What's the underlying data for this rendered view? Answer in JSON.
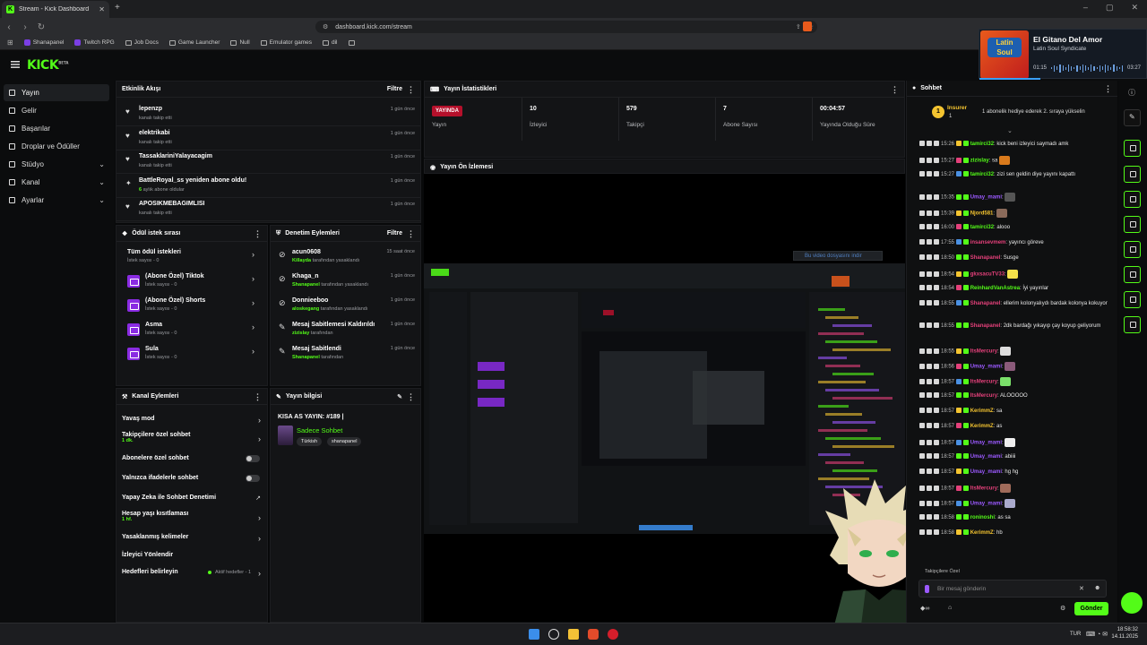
{
  "browser": {
    "tab_title": "Stream - Kick Dashboard",
    "url": "dashboard.kick.com/stream",
    "bookmarks": [
      "Shanapanel",
      "Twitch RPG",
      "Job Docs",
      "Game Launcher",
      "Null",
      "Emulator games",
      "dil",
      ""
    ]
  },
  "music": {
    "title": "El Gitano Del Amor",
    "artist": "Latin Soul Syndicate",
    "album_text": "Latin Soul",
    "elapsed": "01:15",
    "duration": "03:27",
    "progress": 0.36
  },
  "logo": "KICK",
  "logo_sup": "BETA",
  "sidebar": [
    {
      "label": "Yayın",
      "active": true,
      "icon": "broadcast-icon"
    },
    {
      "label": "Gelir",
      "icon": "wallet-icon"
    },
    {
      "label": "Başarılar",
      "icon": "trophy-icon"
    },
    {
      "label": "Droplar ve Ödüller",
      "icon": "gift-icon"
    },
    {
      "label": "Stüdyo",
      "icon": "studio-icon",
      "chevron": true
    },
    {
      "label": "Kanal",
      "icon": "channel-icon",
      "chevron": true
    },
    {
      "label": "Ayarlar",
      "icon": "gear-icon",
      "chevron": true
    }
  ],
  "activity": {
    "title": "Etkinlik Akışı",
    "filter": "Filtre",
    "items": [
      {
        "name": "lepenzp",
        "sub": "kanalı takip etti",
        "time": "1 gün önce"
      },
      {
        "name": "elektrikabi",
        "sub": "kanalı takip etti",
        "time": "1 gün önce"
      },
      {
        "name": "TassaklariniYalayacagim",
        "sub": "kanalı takip etti",
        "time": "1 gün önce"
      },
      {
        "name": "BattleRoyal_ss yeniden abone oldu!",
        "sub_green": "6",
        "sub": " aylık abone oldular",
        "time": "1 gün önce"
      },
      {
        "name": "APOSIKMEBAGIMLISI",
        "sub": "kanalı takip etti",
        "time": "1 gün önce"
      }
    ]
  },
  "rewards": {
    "title": "Ödül istek sırası",
    "items": [
      {
        "title": "Tüm ödül istekleri",
        "sub": "İstek sayısı - 0"
      },
      {
        "title": "(Abone Özel) Tiktok",
        "sub": "İstek sayısı - 0"
      },
      {
        "title": "(Abone Özel) Shorts",
        "sub": "İstek sayısı - 0"
      },
      {
        "title": "Asma",
        "sub": "İstek sayısı - 0"
      },
      {
        "title": "Sula",
        "sub": "İstek sayısı - 0"
      }
    ]
  },
  "moderation": {
    "title": "Denetim Eylemleri",
    "filter": "Filtre",
    "items": [
      {
        "title": "acun0608",
        "by": "Killayda",
        "sub": " tarafından yasaklandı",
        "time": "15 saat önce"
      },
      {
        "title": "Khaga_n",
        "by": "Shanapanel",
        "sub": " tarafından yasaklandı",
        "time": "1 gün önce"
      },
      {
        "title": "Donnieeboo",
        "by": "aloskegang",
        "sub": " tarafından yasaklandı",
        "time": "1 gün önce"
      },
      {
        "title": "Mesaj Sabitlemesi Kaldırıldı",
        "by": "zizislay",
        "sub": " tarafından",
        "time": "1 gün önce"
      },
      {
        "title": "Mesaj Sabitlendi",
        "by": "Shanapanel",
        "sub": " tarafından",
        "time": "1 gün önce"
      }
    ]
  },
  "channel_actions": {
    "title": "Kanal Eylemleri",
    "items": [
      {
        "label": "Yavaş mod",
        "control": "arrow"
      },
      {
        "label": "Takipçilere özel sohbet",
        "sub": "1 dk.",
        "control": "arrow"
      },
      {
        "label": "Abonelere özel sohbet",
        "control": "toggle"
      },
      {
        "label": "Yalnızca ifadelerle sohbet",
        "control": "toggle"
      },
      {
        "label": "Yapay Zeka ile Sohbet Denetimi",
        "control": "external"
      },
      {
        "label": "Hesap yaşı kısıtlaması",
        "sub": "1 hf.",
        "control": "arrow"
      },
      {
        "label": "Yasaklanmış kelimeler",
        "control": "arrow"
      },
      {
        "label": "İzleyici Yönlendir",
        "control": "none"
      },
      {
        "label": "Hedefleri belirleyin",
        "extra": "Aktif hedefler - 1",
        "control": "arrow"
      }
    ]
  },
  "stream_info": {
    "title": "Yayın bilgisi",
    "stream_title": "KISA AS YAYIN: #189 |",
    "category": "Sadece Sohbet",
    "tags": [
      "Türkish",
      "shanapanel"
    ]
  },
  "stats": {
    "title": "Yayın İstatistikleri",
    "live_badge": "YAYINDA",
    "live_label": "Yayın",
    "items": [
      {
        "value": "10",
        "label": "İzleyici"
      },
      {
        "value": "579",
        "label": "Takipçi"
      },
      {
        "value": "7",
        "label": "Abone Sayısı"
      },
      {
        "value": "00:04:57",
        "label": "Yayında Olduğu Süre"
      }
    ]
  },
  "preview": {
    "title": "Yayın Ön İzlemesi",
    "video_notice": "Bu video dosyasını indir"
  },
  "chat": {
    "title": "Sohbet",
    "pinned_user": "Insurer",
    "pinned_count": "1",
    "pinned_text": "1 abonelik hediye ederek 2. sıraya yükselin",
    "messages": [
      {
        "time": "15:26",
        "user": "tamirci32",
        "color": "#53fc18",
        "text": ": kick beni izleyici saymadı amk"
      },
      {
        "time": "15:27",
        "user": "zizislay",
        "color": "#53fc18",
        "text": ": sa"
      },
      {
        "time": "15:27",
        "user": "tamirci32",
        "color": "#53fc18",
        "text": ": zizi sen geldin diye yayını kapattı"
      },
      {
        "time": "15:35",
        "user": "Umay_mami",
        "color": "#9b59ff",
        "text": ":"
      },
      {
        "time": "15:39",
        "user": "Njord581",
        "color": "#f4c430",
        "text": ":"
      },
      {
        "time": "16:00",
        "user": "tamirci32",
        "color": "#53fc18",
        "text": ": alooo"
      },
      {
        "time": "17:55",
        "user": "insansevmem",
        "color": "#e4407a",
        "text": ": yayıncı göreve"
      },
      {
        "time": "18:50",
        "user": "Shanapanel",
        "color": "#e4407a",
        "text": ": Susge"
      },
      {
        "time": "18:54",
        "user": "gkxsacuTV33",
        "color": "#e4407a",
        "text": ":"
      },
      {
        "time": "18:54",
        "user": "ReinhardVanAstrea",
        "color": "#53fc18",
        "text": ": İyi yayınlar"
      },
      {
        "time": "18:55",
        "user": "Shanapanel",
        "color": "#e4407a",
        "text": ": ellerim kolonyalıydı bardak kolonya kokuyor"
      },
      {
        "time": "18:55",
        "user": "Shanapanel",
        "color": "#e4407a",
        "text": ": 2dk bardağı yıkayıp çay koyup geliyorum"
      },
      {
        "time": "18:55",
        "user": "ItsMercury",
        "color": "#e4407a",
        "text": ":"
      },
      {
        "time": "18:56",
        "user": "Umay_mami",
        "color": "#9b59ff",
        "text": ":"
      },
      {
        "time": "18:57",
        "user": "ItsMercury",
        "color": "#e4407a",
        "text": ":"
      },
      {
        "time": "18:57",
        "user": "ItsMercury",
        "color": "#e4407a",
        "text": ": ALOOOOO"
      },
      {
        "time": "18:57",
        "user": "KerimmZ",
        "color": "#f4c430",
        "text": ": sa"
      },
      {
        "time": "18:57",
        "user": "KerimmZ",
        "color": "#f4c430",
        "text": ": as"
      },
      {
        "time": "18:57",
        "user": "Umay_mami",
        "color": "#9b59ff",
        "text": ":"
      },
      {
        "time": "18:57",
        "user": "Umay_mami",
        "color": "#9b59ff",
        "text": ": abiiii"
      },
      {
        "time": "18:57",
        "user": "Umay_mami",
        "color": "#9b59ff",
        "text": ": hg hg"
      },
      {
        "time": "18:57",
        "user": "ItsMercury",
        "color": "#e4407a",
        "text": ":"
      },
      {
        "time": "18:57",
        "user": "Umay_mami",
        "color": "#9b59ff",
        "text": ":"
      },
      {
        "time": "18:58",
        "user": "roninoshi",
        "color": "#53fc18",
        "text": ": as sa"
      },
      {
        "time": "18:58",
        "user": "KerimmZ",
        "color": "#f4c430",
        "text": ": hb"
      }
    ],
    "follower_only": "Takipçilere Özel",
    "input_placeholder": "Bir mesaj gönderin",
    "send": "Gönder"
  },
  "taskbar": {
    "lang": "TUR",
    "time": "18:58:32",
    "date": "14.11.2025"
  }
}
